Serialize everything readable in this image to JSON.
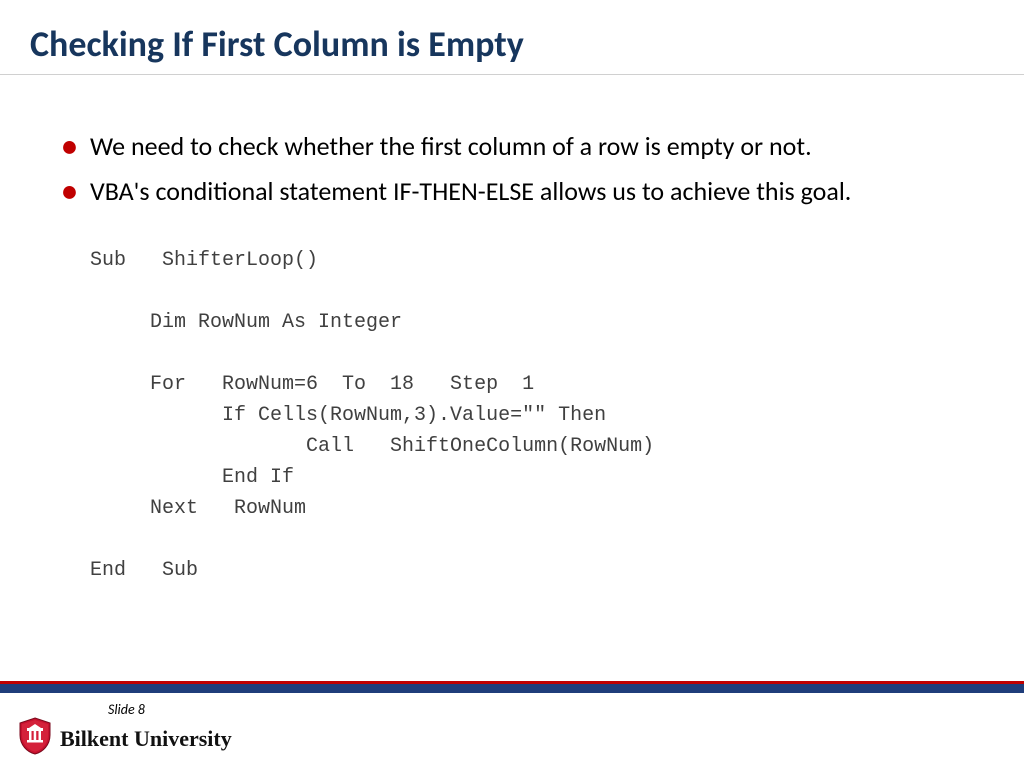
{
  "title": "Checking If First Column is Empty",
  "bullets": [
    "We need to check whether the first column of a row is empty or not.",
    "VBA's conditional statement IF-THEN-ELSE allows us to achieve this  goal."
  ],
  "code": "Sub   ShifterLoop()\n\n     Dim RowNum As Integer\n\n     For   RowNum=6  To  18   Step  1\n           If Cells(RowNum,3).Value=\"\" Then\n                  Call   ShiftOneColumn(RowNum)\n           End If\n     Next   RowNum\n\nEnd   Sub",
  "slide_label": "Slide 8",
  "brand": "Bilkent University"
}
